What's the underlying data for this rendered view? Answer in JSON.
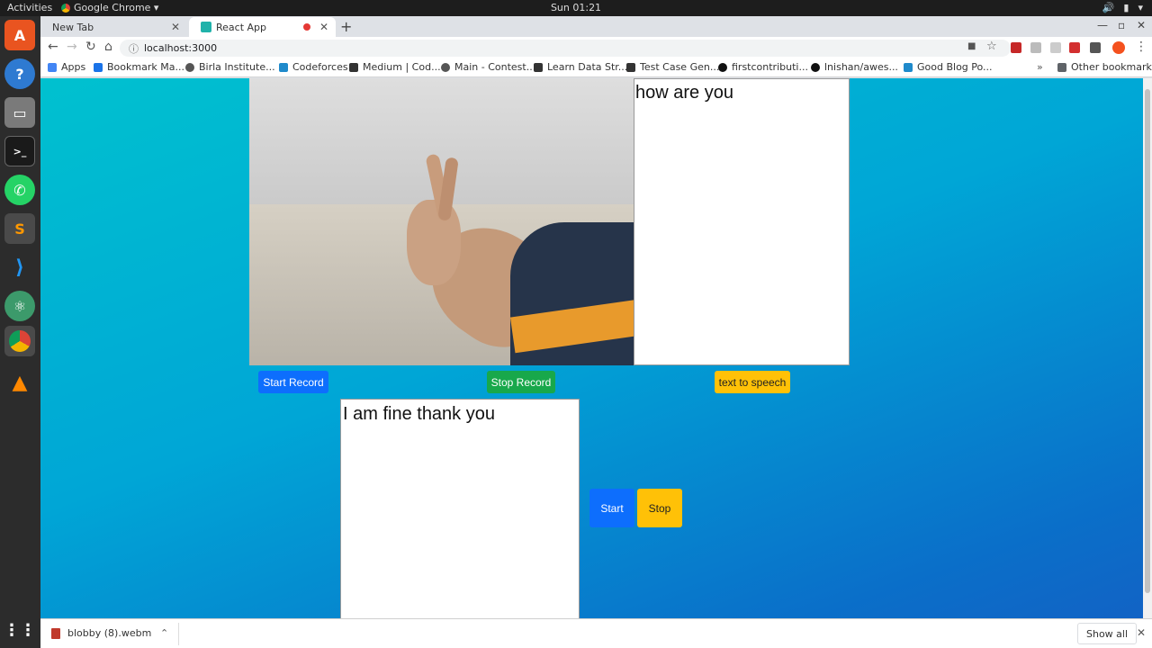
{
  "topbar": {
    "activities": "Activities",
    "app_name": "Google Chrome ▾",
    "clock": "Sun 01:21"
  },
  "tabs": [
    {
      "title": "New Tab"
    },
    {
      "title": "React App"
    }
  ],
  "address": {
    "url": "localhost:3000"
  },
  "bookmarks": [
    {
      "label": "Apps",
      "color": "#4285f4"
    },
    {
      "label": "Bookmark Ma...",
      "color": "#1a73e8"
    },
    {
      "label": "Birla Institute...",
      "color": "#555555"
    },
    {
      "label": "Codeforces",
      "color": "#1f8acb"
    },
    {
      "label": "Medium | Cod...",
      "color": "#333333"
    },
    {
      "label": "Main - Contest...",
      "color": "#555555"
    },
    {
      "label": "Learn Data Str...",
      "color": "#333333"
    },
    {
      "label": "Test Case Gen...",
      "color": "#333333"
    },
    {
      "label": "firstcontributi...",
      "color": "#111111"
    },
    {
      "label": "lnishan/awes...",
      "color": "#111111"
    },
    {
      "label": "Good Blog Po...",
      "color": "#1f8acb"
    },
    {
      "label": "Other bookmarks",
      "color": "#555555"
    }
  ],
  "page": {
    "recognized_text": "how are you",
    "reply_text": "I am fine thank you",
    "buttons": {
      "start_record": "Start Record",
      "stop_record": "Stop Record",
      "text_to_speech": "text to speech",
      "start": "Start",
      "stop": "Stop"
    }
  },
  "download": {
    "filename": "blobby (8).webm",
    "show_all": "Show all"
  },
  "colors": {
    "primary": "#0d6efd",
    "success": "#18a84b",
    "warning": "#ffc107"
  }
}
